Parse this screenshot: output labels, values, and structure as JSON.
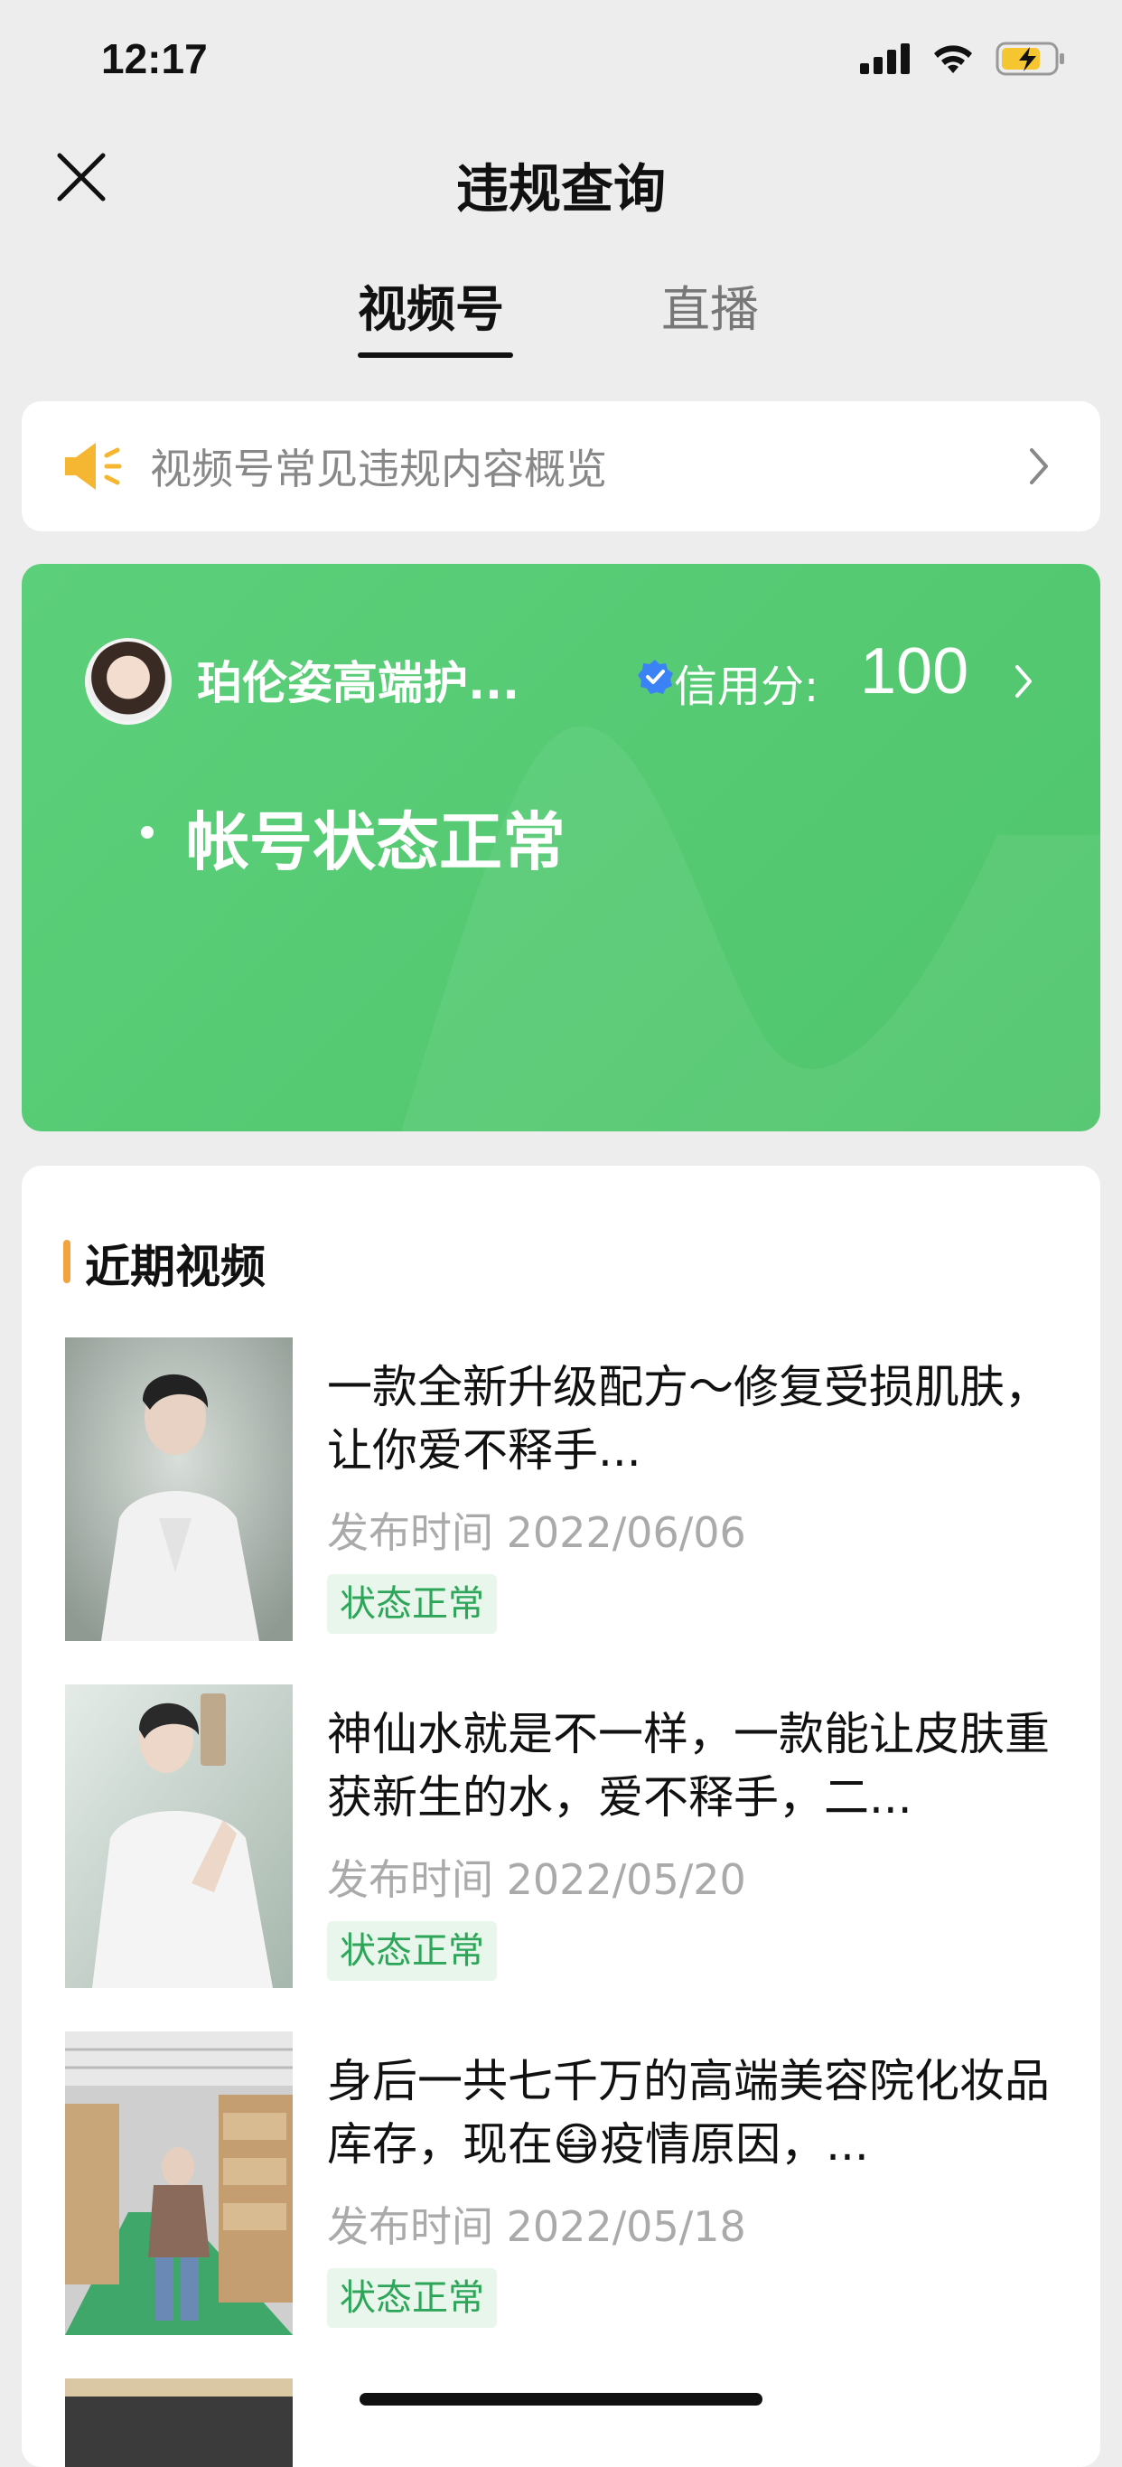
{
  "status_bar": {
    "time": "12:17"
  },
  "header": {
    "title": "违规查询"
  },
  "tabs": [
    {
      "label": "视频号",
      "active": true
    },
    {
      "label": "直播",
      "active": false
    }
  ],
  "notice": {
    "text": "视频号常见违规内容概览"
  },
  "account": {
    "name": "珀伦姿高端护...",
    "credit_label": "信用分:",
    "credit_value": "100",
    "status": "帐号状态正常"
  },
  "recent": {
    "title": "近期视频",
    "items": [
      {
        "title": "一款全新升级配方～修复受损肌肤，让你爱不释手...",
        "date": "发布时间 2022/06/06",
        "status": "状态正常"
      },
      {
        "title": "神仙水就是不一样，一款能让皮肤重获新生的水，爱不释手，二...",
        "date": "发布时间 2022/05/20",
        "status": "状态正常"
      },
      {
        "title": "身后一共七千万的高端美容院化妆品库存，现在😷疫情原因，...",
        "date": "发布时间 2022/05/18",
        "status": "状态正常"
      }
    ]
  },
  "colors": {
    "background": "#ededed",
    "card_green": "#55ca72",
    "accent_orange": "#f0a33e",
    "status_green": "#2ea65a"
  }
}
